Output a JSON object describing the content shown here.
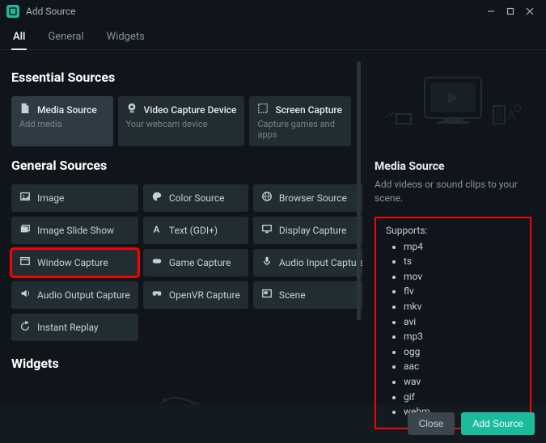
{
  "window": {
    "title": "Add Source"
  },
  "tabs": [
    {
      "label": "All",
      "active": true
    },
    {
      "label": "General",
      "active": false
    },
    {
      "label": "Widgets",
      "active": false
    }
  ],
  "sections": {
    "essential": {
      "title": "Essential Sources",
      "items": [
        {
          "label": "Media Source",
          "sub": "Add media",
          "icon": "file-icon",
          "selected": true
        },
        {
          "label": "Video Capture Device",
          "sub": "Your webcam device",
          "icon": "webcam-icon",
          "selected": false
        },
        {
          "label": "Screen Capture",
          "sub": "Capture games and apps",
          "icon": "dashed-screen-icon",
          "selected": false
        }
      ]
    },
    "general": {
      "title": "General Sources",
      "items": [
        {
          "label": "Image",
          "icon": "image-icon"
        },
        {
          "label": "Color Source",
          "icon": "palette-icon"
        },
        {
          "label": "Browser Source",
          "icon": "globe-icon"
        },
        {
          "label": "Image Slide Show",
          "icon": "slides-icon"
        },
        {
          "label": "Text (GDI+)",
          "icon": "text-icon"
        },
        {
          "label": "Display Capture",
          "icon": "monitor-icon"
        },
        {
          "label": "Window Capture",
          "icon": "window-icon",
          "highlighted": true
        },
        {
          "label": "Game Capture",
          "icon": "gamepad-icon"
        },
        {
          "label": "Audio Input Capture",
          "icon": "mic-icon"
        },
        {
          "label": "Audio Output Capture",
          "icon": "speaker-icon"
        },
        {
          "label": "OpenVR Capture",
          "icon": "vr-icon"
        },
        {
          "label": "Scene",
          "icon": "scene-icon"
        },
        {
          "label": "Instant Replay",
          "icon": "replay-icon"
        }
      ]
    },
    "widgets": {
      "title": "Widgets"
    }
  },
  "detail": {
    "title": "Media Source",
    "desc": "Add videos or sound clips to your scene.",
    "supports_label": "Supports:",
    "formats": [
      "mp4",
      "ts",
      "mov",
      "flv",
      "mkv",
      "avi",
      "mp3",
      "ogg",
      "aac",
      "wav",
      "gif",
      "webm"
    ]
  },
  "footer": {
    "close": "Close",
    "add": "Add Source"
  }
}
